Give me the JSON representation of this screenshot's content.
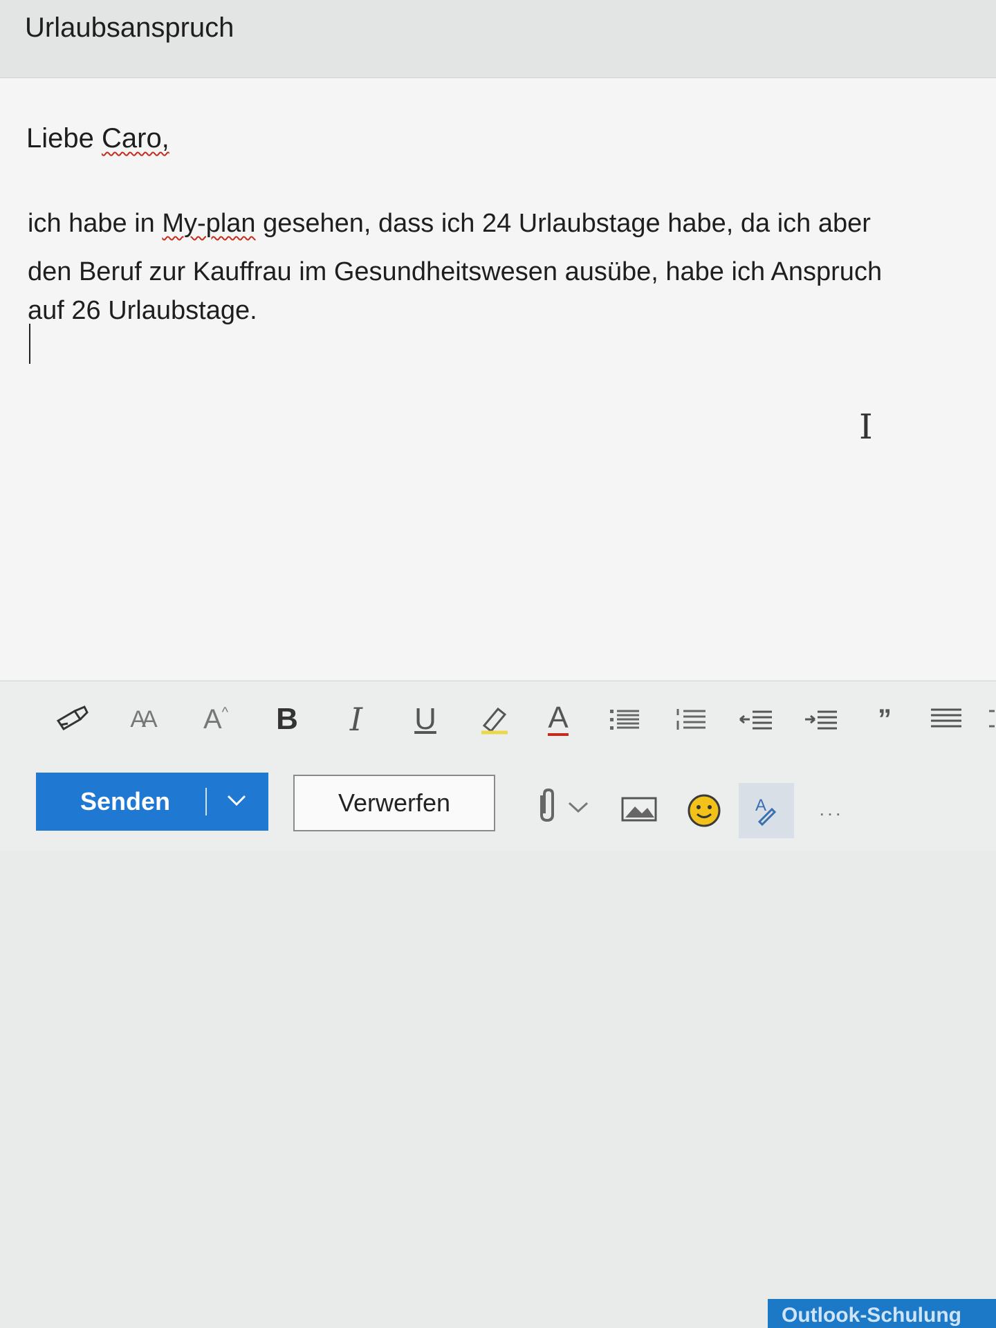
{
  "subject": "Urlaubsanspruch",
  "body": {
    "greeting_prefix": "Liebe ",
    "greeting_name": "Caro,",
    "line1_prefix": "ich habe in ",
    "line1_flag": "My-plan",
    "line1_rest": " gesehen, dass ich 24 Urlaubstage habe, da ich aber",
    "line2": "den Beruf zur Kauffrau im Gesundheitswesen ausübe, habe ich Anspruch",
    "line3": "auf 26 Urlaubstage."
  },
  "format_toolbar": {
    "font_size_label": "AA",
    "font_color_label": "A",
    "bold_label": "B",
    "italic_label": "I",
    "underline_label": "U",
    "text_color_label": "A",
    "quote_label": "”"
  },
  "actions": {
    "send_label": "Senden",
    "discard_label": "Verwerfen",
    "more_label": "..."
  },
  "footer": {
    "link_label": "Outlook-Schulung"
  },
  "colors": {
    "send_button": "#1f78d1",
    "spellcheck": "#c42b1c",
    "emoji": "#f2c21a"
  },
  "icons": [
    "format-painter-icon",
    "font-size-icon",
    "font-color-icon",
    "bold-icon",
    "italic-icon",
    "underline-icon",
    "highlight-icon",
    "text-color-icon",
    "bullets-icon",
    "numbering-icon",
    "decrease-indent-icon",
    "increase-indent-icon",
    "quote-icon",
    "align-icon",
    "chevron-down-icon",
    "paperclip-icon",
    "image-icon",
    "emoji-icon",
    "editor-icon",
    "more-icon"
  ]
}
